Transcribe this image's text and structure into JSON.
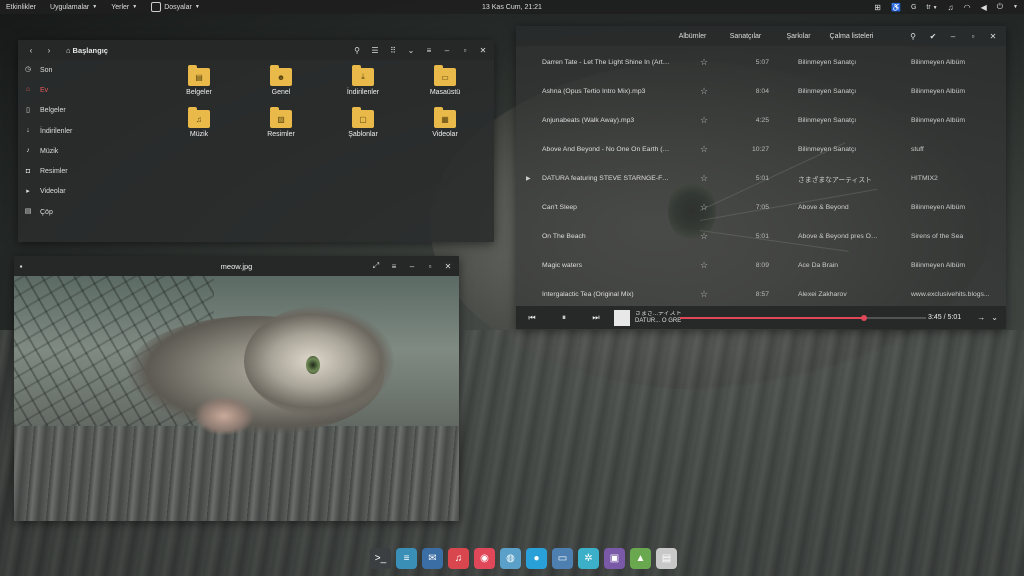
{
  "topbar": {
    "activities": "Etkinlikler",
    "applications": "Uygulamalar",
    "places": "Yerler",
    "files_app": "Dosyalar",
    "clock": "13 Kas Cum, 21:21",
    "input_lang": "tr",
    "g_label": "G"
  },
  "files": {
    "breadcrumb": "Başlangıç",
    "sidebar": [
      {
        "label": "Son",
        "icon": "clock-icon"
      },
      {
        "label": "Ev",
        "icon": "home-icon",
        "active": true
      },
      {
        "label": "Belgeler",
        "icon": "document-icon"
      },
      {
        "label": "İndirilenler",
        "icon": "download-icon"
      },
      {
        "label": "Müzik",
        "icon": "music-icon"
      },
      {
        "label": "Resimler",
        "icon": "camera-icon"
      },
      {
        "label": "Videolar",
        "icon": "video-icon"
      },
      {
        "label": "Çöp",
        "icon": "trash-icon"
      }
    ],
    "folders": [
      {
        "label": "Belgeler",
        "icon": "document-icon"
      },
      {
        "label": "Genel",
        "icon": "people-icon"
      },
      {
        "label": "İndirilenler",
        "icon": "download-icon"
      },
      {
        "label": "Masaüstü",
        "icon": "desktop-icon"
      },
      {
        "label": "Müzik",
        "icon": "music-icon"
      },
      {
        "label": "Resimler",
        "icon": "picture-icon"
      },
      {
        "label": "Şablonlar",
        "icon": "template-icon"
      },
      {
        "label": "Videolar",
        "icon": "film-icon"
      }
    ]
  },
  "music": {
    "tabs": [
      "Albümler",
      "Sanatçılar",
      "Şarkılar",
      "Çalma listeleri"
    ],
    "tracks": [
      {
        "title": "Darren Tate - Let The Light Shine In (Arty R...",
        "duration": "5:07",
        "artist": "Bilinmeyen Sanatçı",
        "album": "Bilinmeyen Albüm"
      },
      {
        "title": "Ashna (Opus Tertio Intro Mix).mp3",
        "duration": "8:04",
        "artist": "Bilinmeyen Sanatçı",
        "album": "Bilinmeyen Albüm"
      },
      {
        "title": "Anjunabeats (Walk Away).mp3",
        "duration": "4:25",
        "artist": "Bilinmeyen Sanatçı",
        "album": "Bilinmeyen Albüm"
      },
      {
        "title": "Above And Beyond - No One On Earth (Ga...",
        "duration": "10:27",
        "artist": "Bilinmeyen Sanatçı",
        "album": "stuff"
      },
      {
        "title": "DATURA featuring STEVE STARNGE-FADET...",
        "duration": "5:01",
        "artist": "さまざまなアーティスト",
        "album": "HITMIX2",
        "playing": true
      },
      {
        "title": "Can't Sleep",
        "duration": "7:05",
        "artist": "Above & Beyond",
        "album": "Bilinmeyen Albüm"
      },
      {
        "title": "On The Beach",
        "duration": "5:01",
        "artist": "Above & Beyond pres Oc...",
        "album": "Sirens of the Sea"
      },
      {
        "title": "Magic waters",
        "duration": "8:09",
        "artist": "Ace Da Brain",
        "album": "Bilinmeyen Albüm"
      },
      {
        "title": "Intergalactic Tea (Original Mix)",
        "duration": "8:57",
        "artist": "Alexei Zakharov",
        "album": "www.exclusivehits.blogs..."
      }
    ],
    "now_playing": {
      "artist": "さまざ...ティスト",
      "title": "DATUR... O GREY",
      "elapsed": "3:45",
      "separator": "/",
      "total": "5:01",
      "progress_fraction": 0.747
    }
  },
  "viewer": {
    "title": "meow.jpg"
  },
  "dock": [
    {
      "name": "terminal-icon",
      "color": "#3c3f41",
      "glyph": ">_"
    },
    {
      "name": "notes-icon",
      "color": "#3a8fb7",
      "glyph": "≡"
    },
    {
      "name": "mail-icon",
      "color": "#3b6ea5",
      "glyph": "✉"
    },
    {
      "name": "music-icon",
      "color": "#d9474e",
      "glyph": "♫"
    },
    {
      "name": "browser-icon",
      "color": "#e0485a",
      "glyph": "◉"
    },
    {
      "name": "web-icon",
      "color": "#5aa0c8",
      "glyph": "◍"
    },
    {
      "name": "chat-icon",
      "color": "#2aa0d8",
      "glyph": "●"
    },
    {
      "name": "screen-icon",
      "color": "#4d7fb0",
      "glyph": "▭"
    },
    {
      "name": "settings-icon",
      "color": "#3bb0c8",
      "glyph": "✲"
    },
    {
      "name": "software-icon",
      "color": "#7a5aa8",
      "glyph": "▣"
    },
    {
      "name": "photos-icon",
      "color": "#6aa84f",
      "glyph": "▲"
    },
    {
      "name": "document-viewer-icon",
      "color": "#c8c8c8",
      "glyph": "▤"
    }
  ]
}
